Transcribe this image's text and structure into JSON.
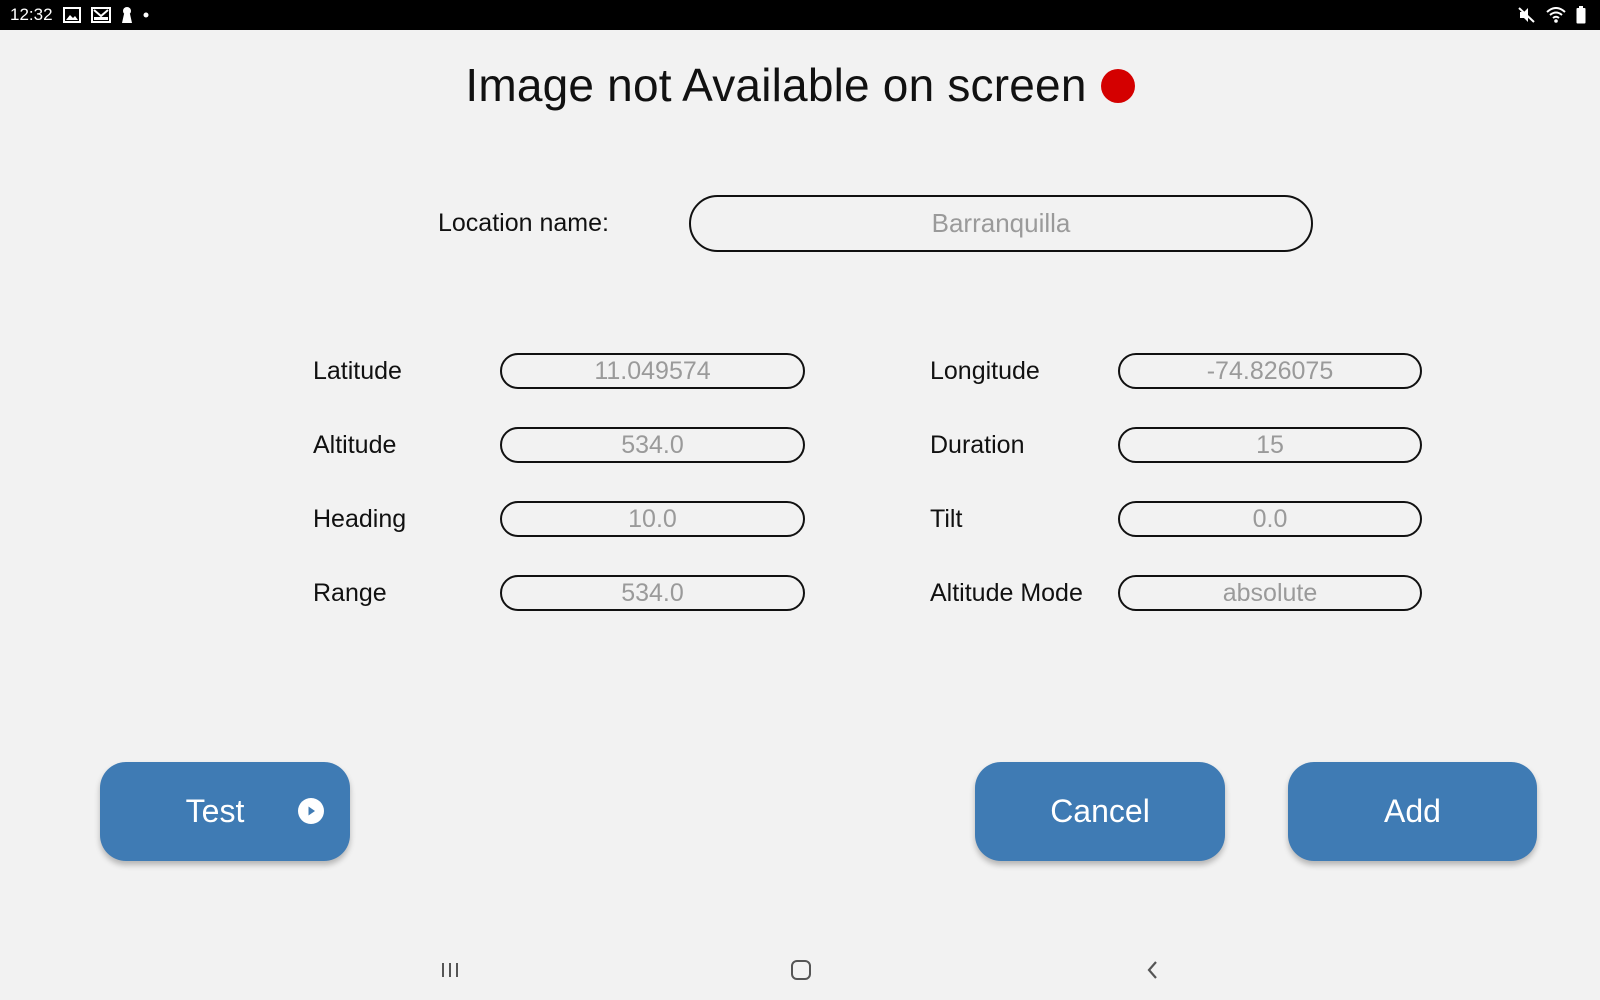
{
  "status_bar": {
    "time": "12:32",
    "left_icons": [
      "image-icon",
      "mail-icon",
      "keyhole-icon",
      "dot-icon"
    ],
    "right_icons": [
      "mute-icon",
      "wifi-icon",
      "battery-icon"
    ]
  },
  "header": {
    "title": "Image not Available on screen",
    "status_color": "#d40000"
  },
  "location": {
    "label": "Location name:",
    "placeholder": "Barranquilla"
  },
  "fields": {
    "latitude": {
      "label": "Latitude",
      "placeholder": "11.049574"
    },
    "longitude": {
      "label": "Longitude",
      "placeholder": "-74.826075"
    },
    "altitude": {
      "label": "Altitude",
      "placeholder": "534.0"
    },
    "duration": {
      "label": "Duration",
      "placeholder": "15"
    },
    "heading": {
      "label": "Heading",
      "placeholder": "10.0"
    },
    "tilt": {
      "label": "Tilt",
      "placeholder": "0.0"
    },
    "range": {
      "label": "Range",
      "placeholder": "534.0"
    },
    "altitude_mode": {
      "label": "Altitude Mode",
      "placeholder": "absolute"
    }
  },
  "buttons": {
    "test": "Test",
    "cancel": "Cancel",
    "add": "Add"
  },
  "colors": {
    "button_bg": "#3f7bb4",
    "background": "#f2f2f2"
  },
  "navigation": {
    "icons": [
      "recent-apps-icon",
      "home-icon",
      "back-icon"
    ]
  }
}
